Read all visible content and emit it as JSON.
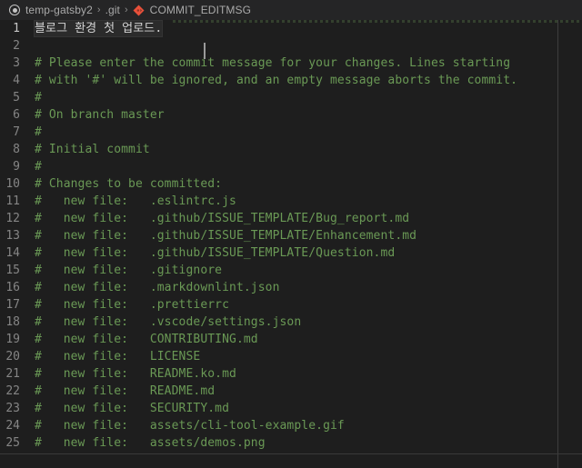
{
  "breadcrumb": {
    "icon": "circle-dot-icon",
    "separator": "›",
    "items": [
      {
        "label": "temp-gatsby2"
      },
      {
        "label": ".git"
      },
      {
        "label": "COMMIT_EDITMSG",
        "icon": "git-file-icon"
      }
    ]
  },
  "editor": {
    "filename": "COMMIT_EDITMSG",
    "language": "git-commit",
    "cursor_line": 1,
    "colors": {
      "background": "#1e1e1e",
      "breadcrumb_background": "#252526",
      "comment": "#6a9955",
      "text": "#d4d4d4",
      "line_number": "#858585",
      "line_number_active": "#c6c6c6",
      "git_icon": "#e8503a"
    },
    "lines": [
      {
        "n": "1",
        "text": "블로그 환경 첫 업로드.",
        "type": "text",
        "active": true
      },
      {
        "n": "2",
        "text": "",
        "type": "text"
      },
      {
        "n": "3",
        "text": "# Please enter the commit message for your changes. Lines starting",
        "type": "comment"
      },
      {
        "n": "4",
        "text": "# with '#' will be ignored, and an empty message aborts the commit.",
        "type": "comment"
      },
      {
        "n": "5",
        "text": "#",
        "type": "comment"
      },
      {
        "n": "6",
        "text": "# On branch master",
        "type": "comment"
      },
      {
        "n": "7",
        "text": "#",
        "type": "comment"
      },
      {
        "n": "8",
        "text": "# Initial commit",
        "type": "comment"
      },
      {
        "n": "9",
        "text": "#",
        "type": "comment"
      },
      {
        "n": "10",
        "text": "# Changes to be committed:",
        "type": "comment"
      },
      {
        "n": "11",
        "text": "#\tnew file:   .eslintrc.js",
        "type": "comment"
      },
      {
        "n": "12",
        "text": "#\tnew file:   .github/ISSUE_TEMPLATE/Bug_report.md",
        "type": "comment"
      },
      {
        "n": "13",
        "text": "#\tnew file:   .github/ISSUE_TEMPLATE/Enhancement.md",
        "type": "comment"
      },
      {
        "n": "14",
        "text": "#\tnew file:   .github/ISSUE_TEMPLATE/Question.md",
        "type": "comment"
      },
      {
        "n": "15",
        "text": "#\tnew file:   .gitignore",
        "type": "comment"
      },
      {
        "n": "16",
        "text": "#\tnew file:   .markdownlint.json",
        "type": "comment"
      },
      {
        "n": "17",
        "text": "#\tnew file:   .prettierrc",
        "type": "comment"
      },
      {
        "n": "18",
        "text": "#\tnew file:   .vscode/settings.json",
        "type": "comment"
      },
      {
        "n": "19",
        "text": "#\tnew file:   CONTRIBUTING.md",
        "type": "comment"
      },
      {
        "n": "20",
        "text": "#\tnew file:   LICENSE",
        "type": "comment"
      },
      {
        "n": "21",
        "text": "#\tnew file:   README.ko.md",
        "type": "comment"
      },
      {
        "n": "22",
        "text": "#\tnew file:   README.md",
        "type": "comment"
      },
      {
        "n": "23",
        "text": "#\tnew file:   SECURITY.md",
        "type": "comment"
      },
      {
        "n": "24",
        "text": "#\tnew file:   assets/cli-tool-example.gif",
        "type": "comment"
      },
      {
        "n": "25",
        "text": "#\tnew file:   assets/demos.png",
        "type": "comment"
      }
    ]
  }
}
